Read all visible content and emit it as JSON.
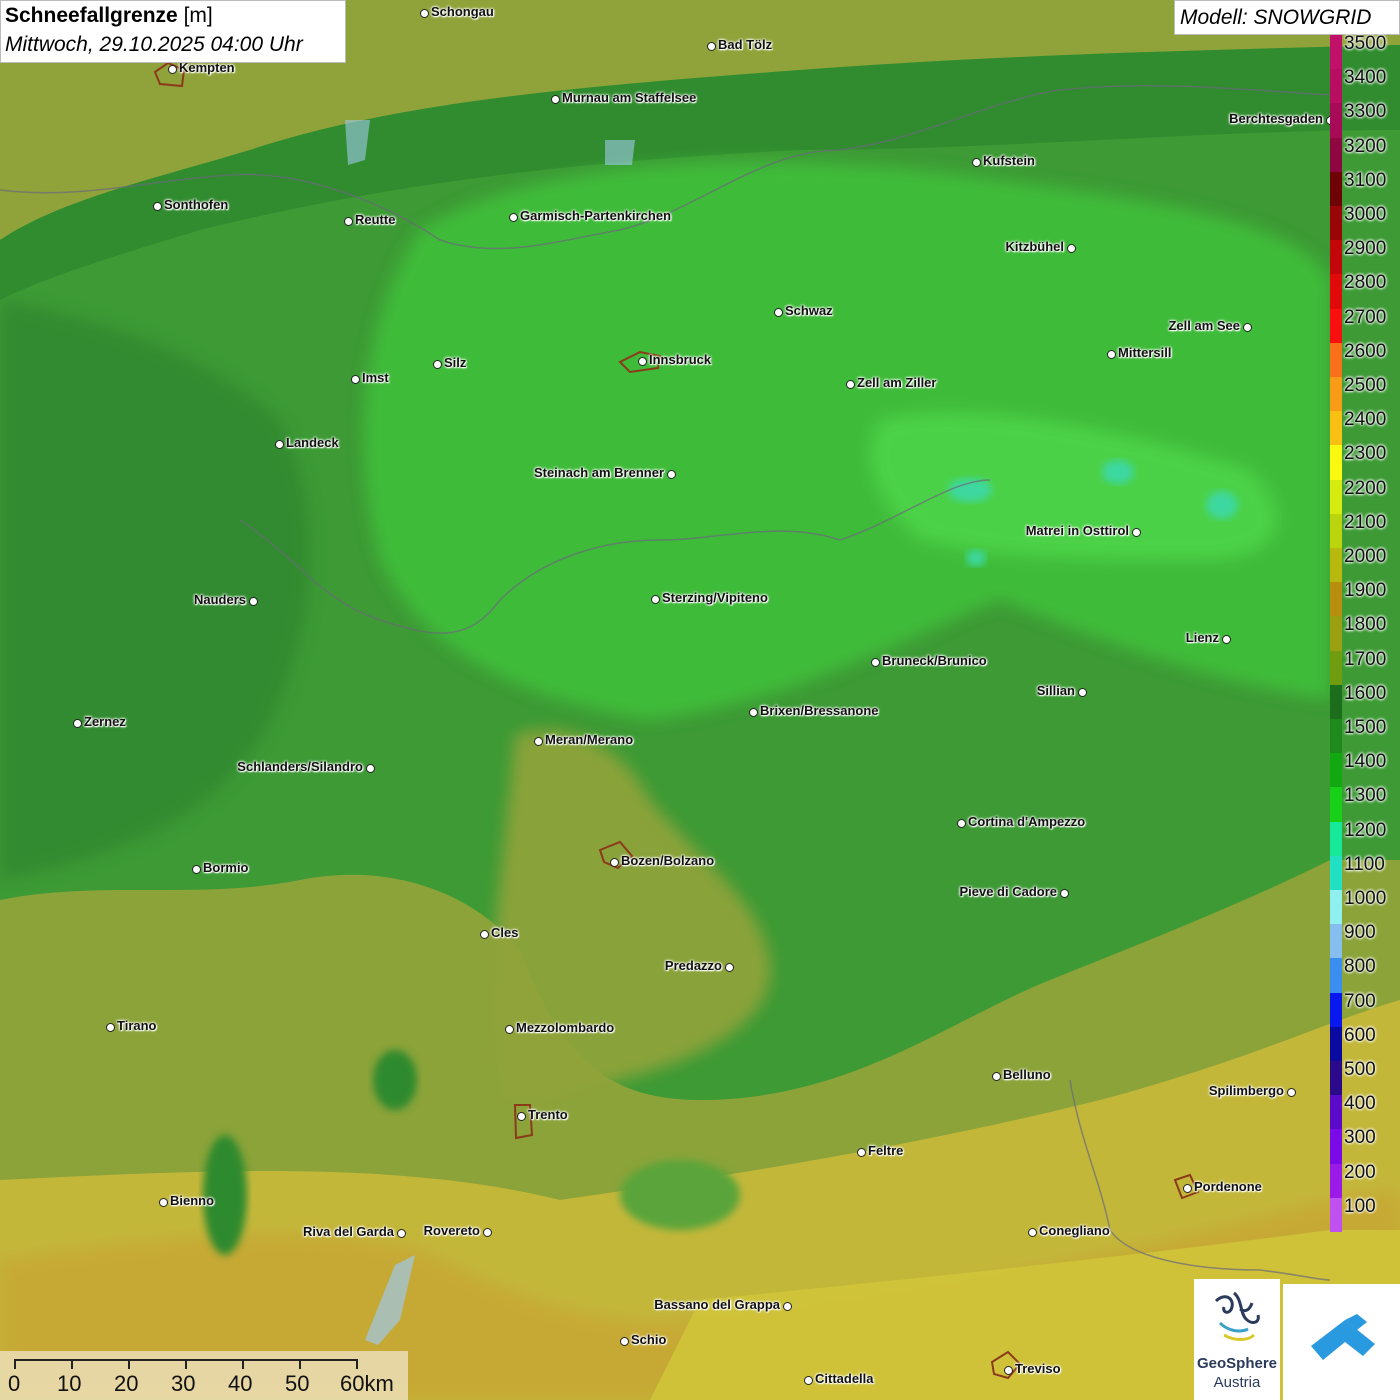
{
  "header": {
    "title": "Schneefallgrenze",
    "unit": "[m]",
    "datetime": "Mittwoch, 29.10.2025 04:00 Uhr"
  },
  "model": {
    "label": "Modell: SNOWGRID"
  },
  "legend": {
    "items": [
      {
        "value": "3500",
        "color": "#c0106a"
      },
      {
        "value": "3400",
        "color": "#b80e62"
      },
      {
        "value": "3300",
        "color": "#a70b58"
      },
      {
        "value": "3200",
        "color": "#8e0740"
      },
      {
        "value": "3100",
        "color": "#6e0408"
      },
      {
        "value": "3000",
        "color": "#9a0508"
      },
      {
        "value": "2900",
        "color": "#c2060a"
      },
      {
        "value": "2800",
        "color": "#e00a0a"
      },
      {
        "value": "2700",
        "color": "#f81010"
      },
      {
        "value": "2600",
        "color": "#f8701a"
      },
      {
        "value": "2500",
        "color": "#f89c18"
      },
      {
        "value": "2400",
        "color": "#f8c012"
      },
      {
        "value": "2300",
        "color": "#f8f810"
      },
      {
        "value": "2200",
        "color": "#d6ec10"
      },
      {
        "value": "2100",
        "color": "#bad40e"
      },
      {
        "value": "2000",
        "color": "#b8b80e"
      },
      {
        "value": "1900",
        "color": "#b88e0e"
      },
      {
        "value": "1800",
        "color": "#9aa012"
      },
      {
        "value": "1700",
        "color": "#709c10"
      },
      {
        "value": "1600",
        "color": "#1c6e1c"
      },
      {
        "value": "1500",
        "color": "#1e8a1e"
      },
      {
        "value": "1400",
        "color": "#12a812"
      },
      {
        "value": "1300",
        "color": "#18d018"
      },
      {
        "value": "1200",
        "color": "#18e89a"
      },
      {
        "value": "1100",
        "color": "#22e0c4"
      },
      {
        "value": "1000",
        "color": "#90f0f0"
      },
      {
        "value": "900",
        "color": "#86bef0"
      },
      {
        "value": "800",
        "color": "#3a8ef0"
      },
      {
        "value": "700",
        "color": "#0a18f0"
      },
      {
        "value": "600",
        "color": "#0a0aa0"
      },
      {
        "value": "500",
        "color": "#2a0a8a"
      },
      {
        "value": "400",
        "color": "#5a0ac8"
      },
      {
        "value": "300",
        "color": "#7a0ae8"
      },
      {
        "value": "200",
        "color": "#9a1ae8"
      },
      {
        "value": "100",
        "color": "#c050f0"
      }
    ]
  },
  "scale": {
    "labels": [
      "0",
      "10",
      "20",
      "30",
      "40",
      "50",
      "60km"
    ]
  },
  "logos": {
    "geosphere_line1": "GeoSphere",
    "geosphere_line2": "Austria"
  },
  "cities": [
    {
      "name": "Schongau"
    },
    {
      "name": "Bad Tölz"
    },
    {
      "name": "Kempten"
    },
    {
      "name": "Murnau am Staffelsee"
    },
    {
      "name": "Berchtesgaden"
    },
    {
      "name": "Kufstein"
    },
    {
      "name": "Sonthofen"
    },
    {
      "name": "Reutte"
    },
    {
      "name": "Garmisch-Partenkirchen"
    },
    {
      "name": "Kitzbühel"
    },
    {
      "name": "Schwaz"
    },
    {
      "name": "Zell am See"
    },
    {
      "name": "Innsbruck"
    },
    {
      "name": "Mittersill"
    },
    {
      "name": "Imst"
    },
    {
      "name": "Silz"
    },
    {
      "name": "Zell am Ziller"
    },
    {
      "name": "Landeck"
    },
    {
      "name": "Steinach am Brenner"
    },
    {
      "name": "Matrei in Osttirol"
    },
    {
      "name": "Nauders"
    },
    {
      "name": "Sterzing/Vipiteno"
    },
    {
      "name": "Lienz"
    },
    {
      "name": "Bruneck/Brunico"
    },
    {
      "name": "Sillian"
    },
    {
      "name": "Zernez"
    },
    {
      "name": "Brixen/Bressanone"
    },
    {
      "name": "Meran/Merano"
    },
    {
      "name": "Schlanders/Silandro"
    },
    {
      "name": "Cortina d'Ampezzo"
    },
    {
      "name": "Bozen/Bolzano"
    },
    {
      "name": "Bormio"
    },
    {
      "name": "Pieve di Cadore"
    },
    {
      "name": "Cles"
    },
    {
      "name": "Predazzo"
    },
    {
      "name": "Tirano"
    },
    {
      "name": "Mezzolombardo"
    },
    {
      "name": "Belluno"
    },
    {
      "name": "Spilimbergo"
    },
    {
      "name": "Trento"
    },
    {
      "name": "Feltre"
    },
    {
      "name": "Pordenone"
    },
    {
      "name": "Bienno"
    },
    {
      "name": "Riva del Garda"
    },
    {
      "name": "Rovereto"
    },
    {
      "name": "Conegliano"
    },
    {
      "name": "Bassano del Grappa"
    },
    {
      "name": "Schio"
    },
    {
      "name": "Treviso"
    },
    {
      "name": "Cittadella"
    }
  ]
}
